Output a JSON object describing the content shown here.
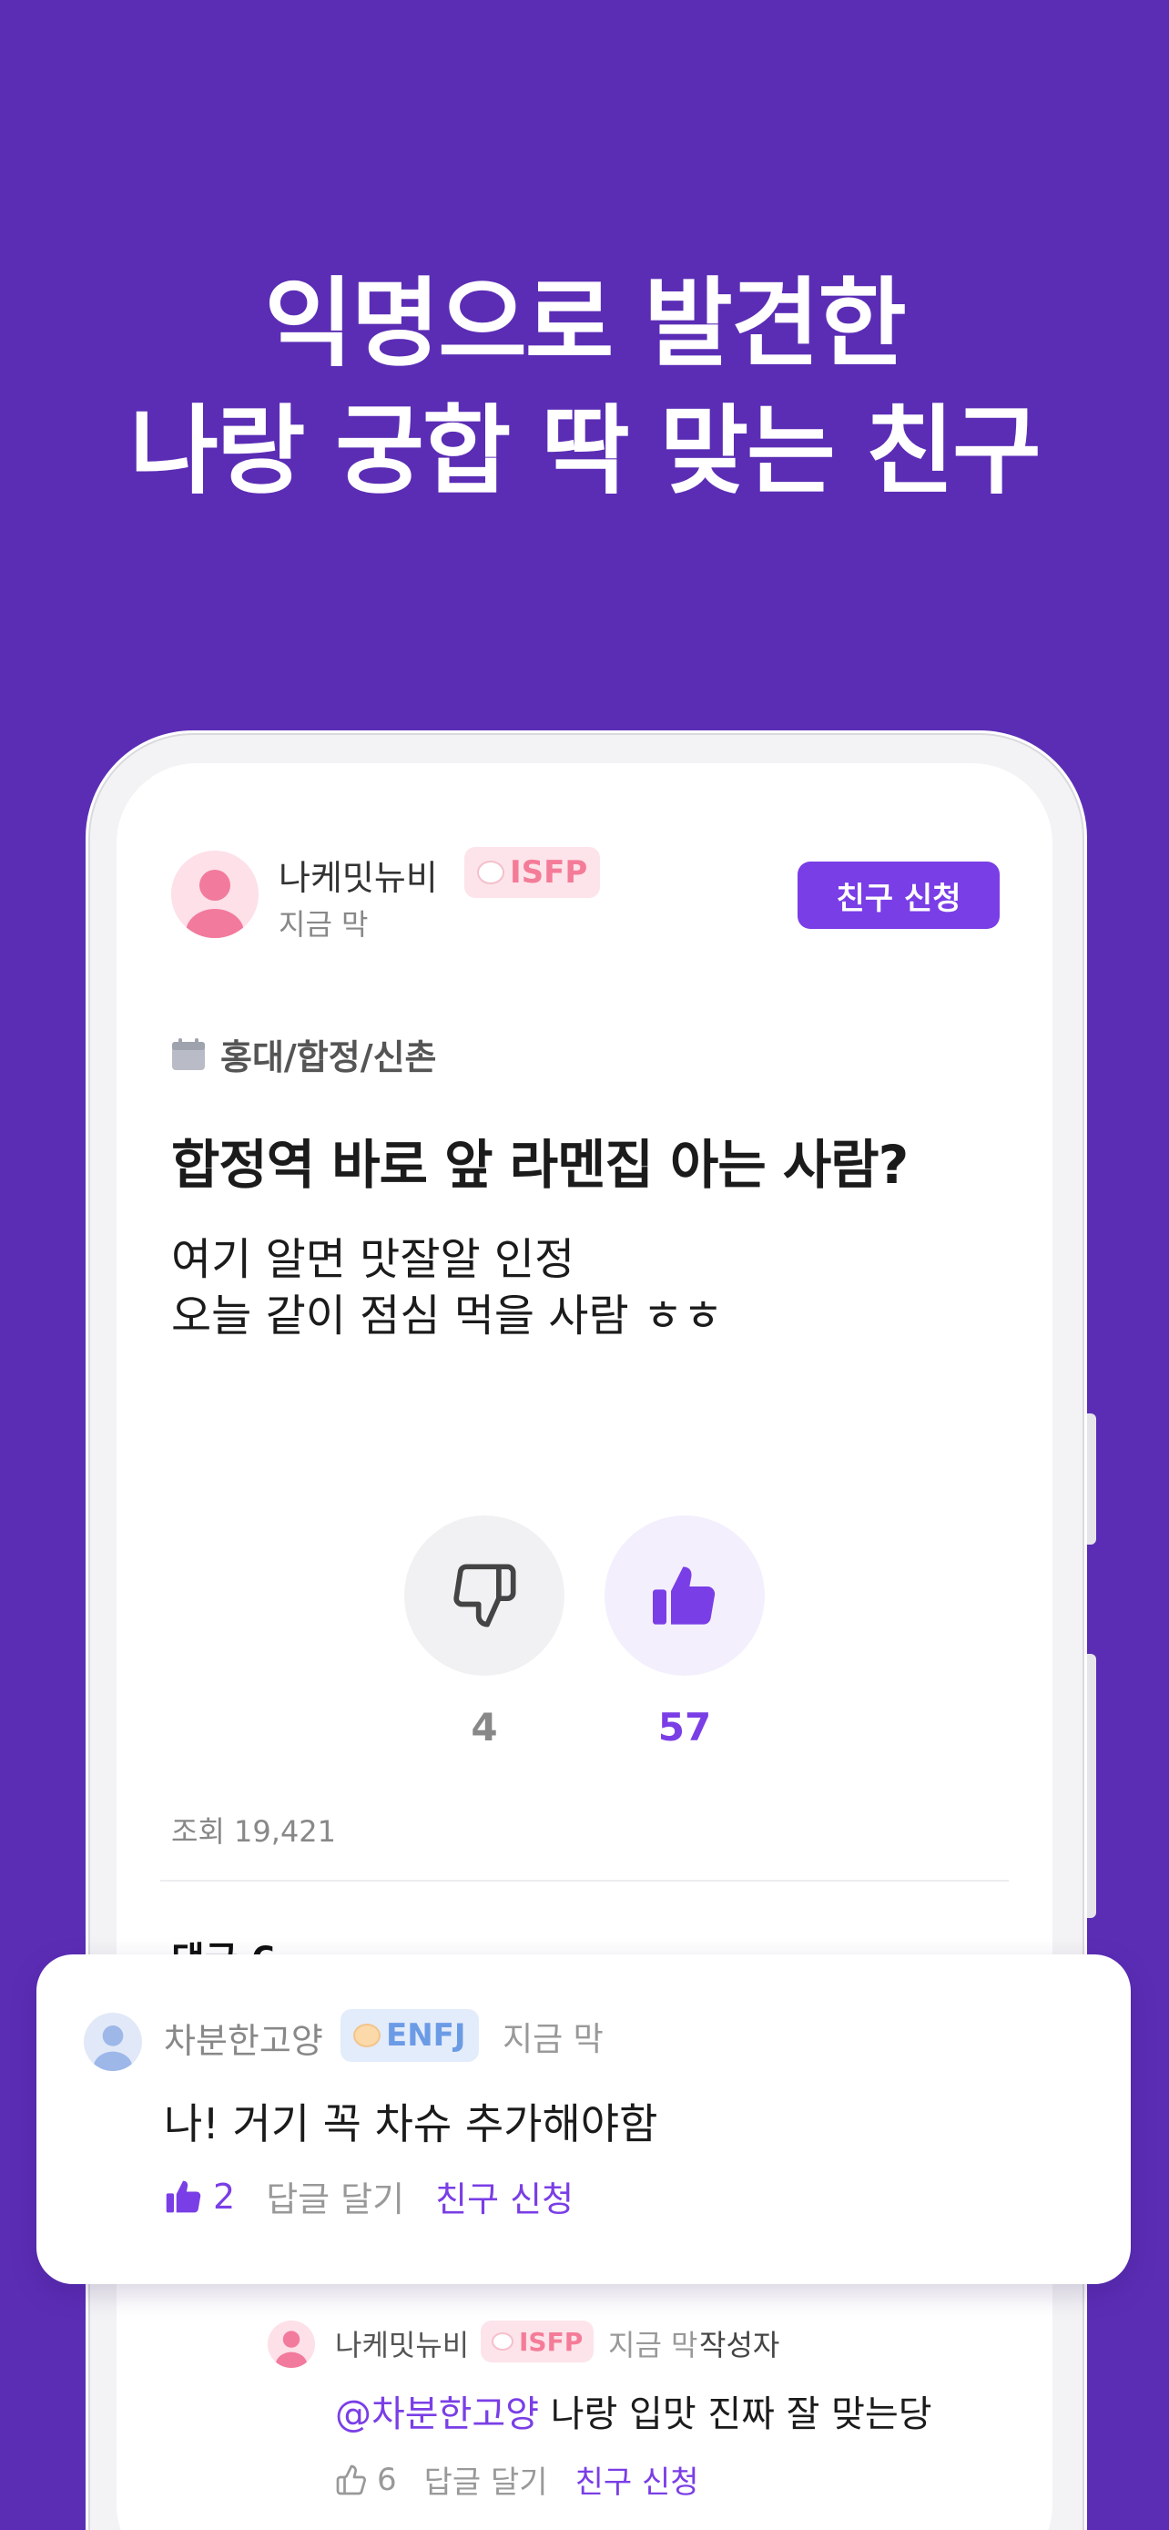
{
  "headline": {
    "line1": "익명으로 발견한",
    "line2": "나랑 궁합 딱 맞는 친구"
  },
  "post": {
    "author": "나케밋뉴비",
    "mbti": "ISFP",
    "time": "지금 막",
    "friend_button": "친구 신청",
    "location": "홍대/합정/신촌",
    "title": "합정역 바로 앞 라멘집 아는 사람?",
    "body_line1": "여기 알면 맛잘알 인정",
    "body_line2": "오늘 같이 점심 먹을 사람 ㅎㅎ",
    "dislike_count": "4",
    "like_count": "57",
    "views": "조회 19,421",
    "comments_header": "댓글 6"
  },
  "comment": {
    "author": "차분한고양",
    "mbti": "ENFJ",
    "time": "지금 막",
    "text": "나! 거기 꼭 차슈 추가해야함",
    "likes": "2",
    "reply_label": "답글 달기",
    "friend_label": "친구 신청"
  },
  "reply": {
    "author": "나케밋뉴비",
    "mbti": "ISFP",
    "time": "지금 막",
    "author_tag": "작성자",
    "mention": "@차분한고양",
    "text": " 나랑 입맛 진짜 잘 맞는당",
    "likes": "6",
    "reply_label": "답글 달기",
    "friend_label": "친구 신청"
  },
  "colors": {
    "background": "#5b2db5",
    "accent": "#7a3ee6",
    "pink_badge": "#f47c98",
    "blue_badge": "#6c9be6"
  }
}
